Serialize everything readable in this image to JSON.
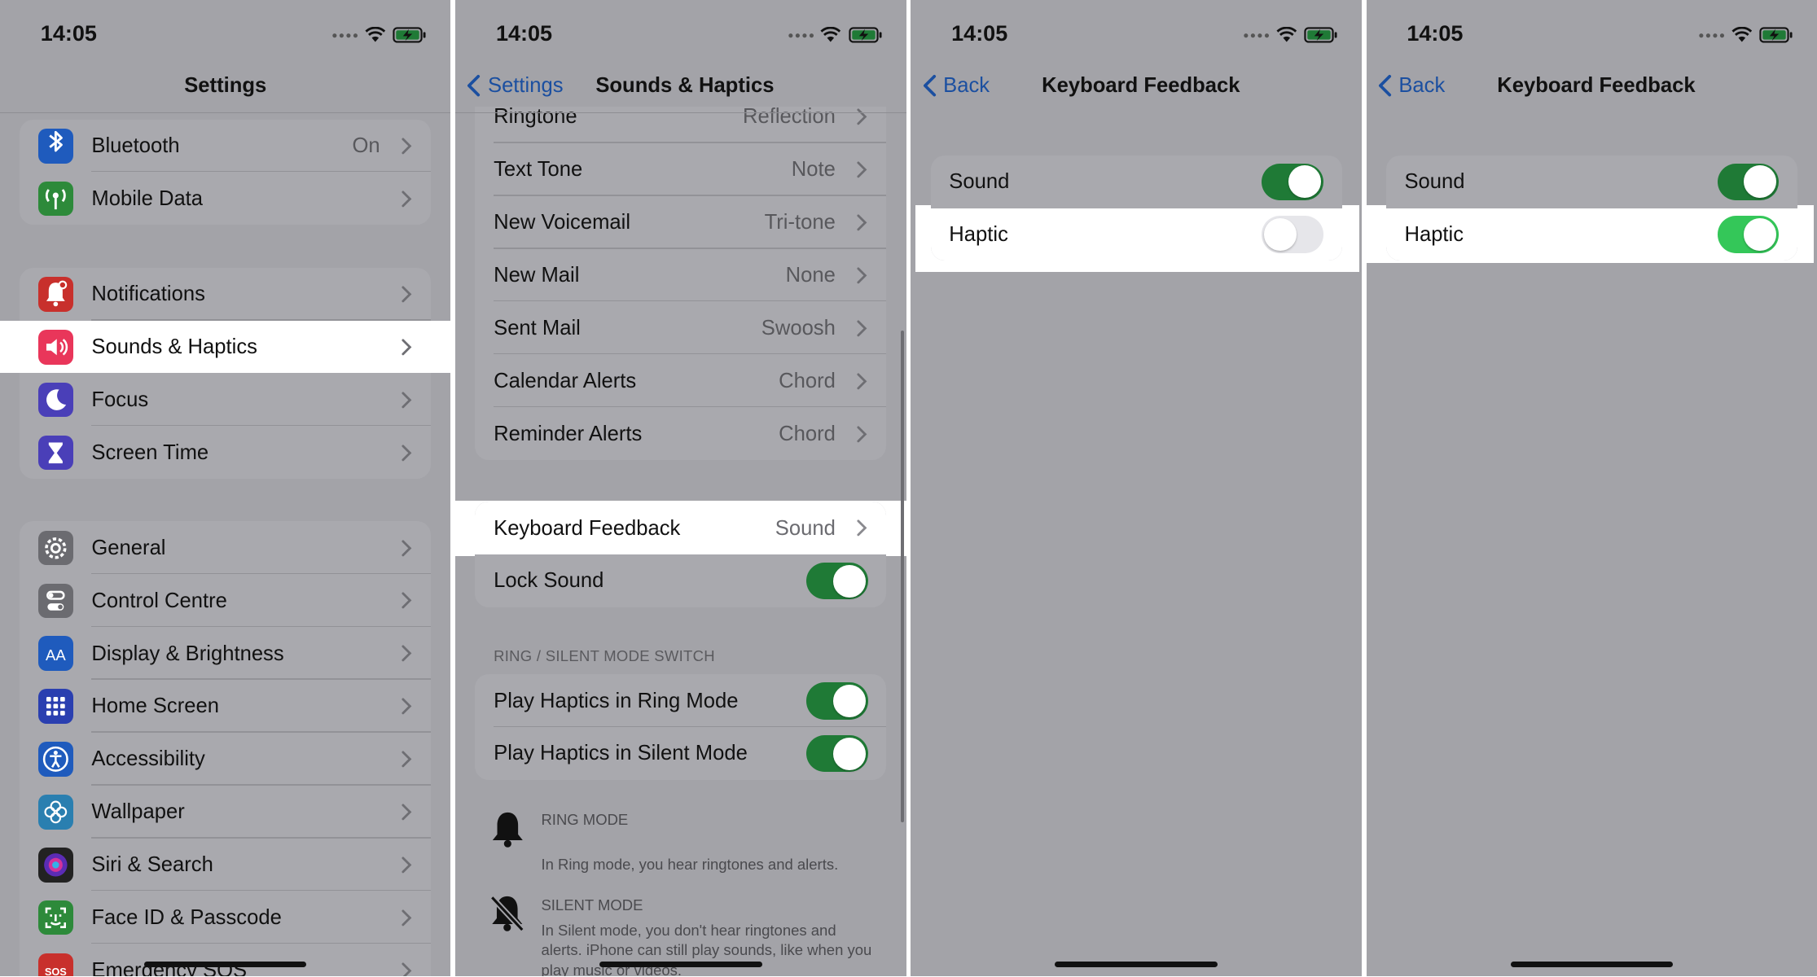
{
  "status": {
    "time": "14:05"
  },
  "colors": {
    "accent": "#1b4fa0",
    "toggle_on": "#1f7a36",
    "toggle_on_bright": "#34c759",
    "background": "#a3a3a8"
  },
  "screen1": {
    "title": "Settings",
    "group1": [
      {
        "label": "Bluetooth",
        "value": "On",
        "icon": "bluetooth-icon",
        "color": "#1f5bbd"
      },
      {
        "label": "Mobile Data",
        "icon": "antenna-icon",
        "color": "#2d8a3a"
      }
    ],
    "group2": [
      {
        "label": "Notifications",
        "icon": "bell-icon",
        "color": "#c8302c"
      },
      {
        "label": "Sounds & Haptics",
        "icon": "speaker-icon",
        "color": "#e9365a",
        "highlighted": true
      },
      {
        "label": "Focus",
        "icon": "moon-icon",
        "color": "#4a3fb8"
      },
      {
        "label": "Screen Time",
        "icon": "hourglass-icon",
        "color": "#4a3fb8"
      }
    ],
    "group3": [
      {
        "label": "General",
        "icon": "gear-icon",
        "color": "#6b6b70"
      },
      {
        "label": "Control Centre",
        "icon": "switches-icon",
        "color": "#6b6b70"
      },
      {
        "label": "Display & Brightness",
        "icon": "text-size-icon",
        "color": "#1f5bbd"
      },
      {
        "label": "Home Screen",
        "icon": "app-grid-icon",
        "color": "#2a3fb0"
      },
      {
        "label": "Accessibility",
        "icon": "accessibility-icon",
        "color": "#1f5bbd"
      },
      {
        "label": "Wallpaper",
        "icon": "flower-icon",
        "color": "#2a7fb0"
      },
      {
        "label": "Siri & Search",
        "icon": "siri-icon",
        "color": "#222"
      },
      {
        "label": "Face ID & Passcode",
        "icon": "face-id-icon",
        "color": "#2d8a3a"
      },
      {
        "label": "Emergency SOS",
        "icon": "sos-icon",
        "color": "#c8302c"
      }
    ]
  },
  "screen2": {
    "back": "Settings",
    "title": "Sounds & Haptics",
    "tones": [
      {
        "label": "Ringtone",
        "value": "Reflection"
      },
      {
        "label": "Text Tone",
        "value": "Note"
      },
      {
        "label": "New Voicemail",
        "value": "Tri-tone"
      },
      {
        "label": "New Mail",
        "value": "None"
      },
      {
        "label": "Sent Mail",
        "value": "Swoosh"
      },
      {
        "label": "Calendar Alerts",
        "value": "Chord"
      },
      {
        "label": "Reminder Alerts",
        "value": "Chord"
      }
    ],
    "keyboard_feedback": {
      "label": "Keyboard Feedback",
      "value": "Sound"
    },
    "lock_sound": {
      "label": "Lock Sound",
      "on": true
    },
    "ring_header": "RING / SILENT MODE SWITCH",
    "ring_haptics": {
      "label": "Play Haptics in Ring Mode",
      "on": true
    },
    "silent_haptics": {
      "label": "Play Haptics in Silent Mode",
      "on": true
    },
    "ring_mode": {
      "title": "RING MODE",
      "desc": "In Ring mode, you hear ringtones and alerts."
    },
    "silent_mode": {
      "title": "SILENT MODE",
      "desc": "In Silent mode, you don't hear ringtones and alerts. iPhone can still play sounds, like when you play music or videos."
    }
  },
  "screen3": {
    "back": "Back",
    "title": "Keyboard Feedback",
    "sound": {
      "label": "Sound",
      "on": true
    },
    "haptic": {
      "label": "Haptic",
      "on": false
    }
  },
  "screen4": {
    "back": "Back",
    "title": "Keyboard Feedback",
    "sound": {
      "label": "Sound",
      "on": true
    },
    "haptic": {
      "label": "Haptic",
      "on": true
    }
  }
}
